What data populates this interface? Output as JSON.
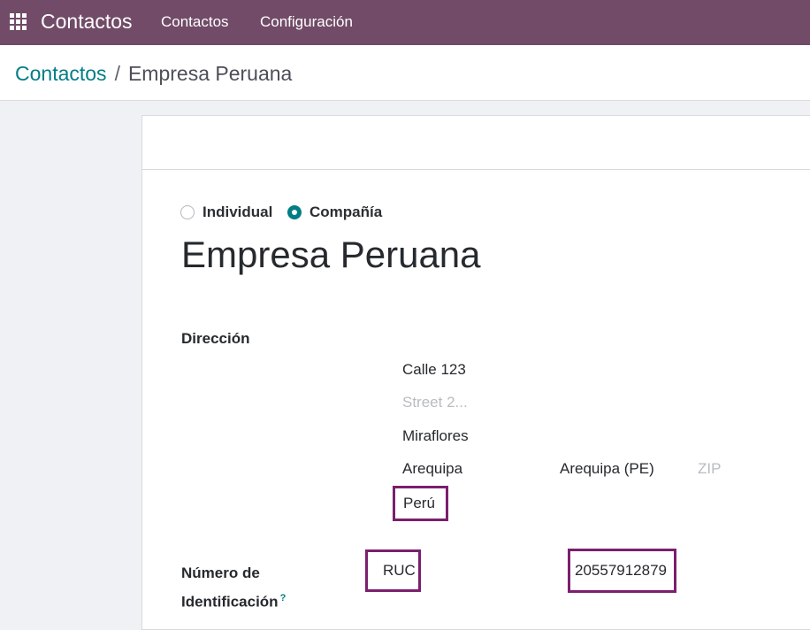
{
  "navbar": {
    "app_name": "Contactos",
    "menu": [
      "Contactos",
      "Configuración"
    ],
    "apps_icon": "grid-icon",
    "color": "#714b67"
  },
  "breadcrumb": {
    "parent": "Contactos",
    "separator": "/",
    "current": "Empresa Peruana"
  },
  "form": {
    "company_type": {
      "options": [
        "Individual",
        "Compañía"
      ],
      "selected": "Compañía"
    },
    "name": "Empresa Peruana",
    "address": {
      "label": "Dirección",
      "street": "Calle 123",
      "street2_placeholder": "Street 2...",
      "city": "Miraflores",
      "state_city": "Arequipa",
      "state": "Arequipa (PE)",
      "zip_placeholder": "ZIP",
      "country": "Perú"
    },
    "identification": {
      "label_line1": "Número de",
      "label_line2": "Identificación",
      "help": "?",
      "type": "RUC",
      "number": "20557912879"
    }
  },
  "colors": {
    "accent": "#017e84",
    "highlight_border": "#7b1f6e"
  }
}
